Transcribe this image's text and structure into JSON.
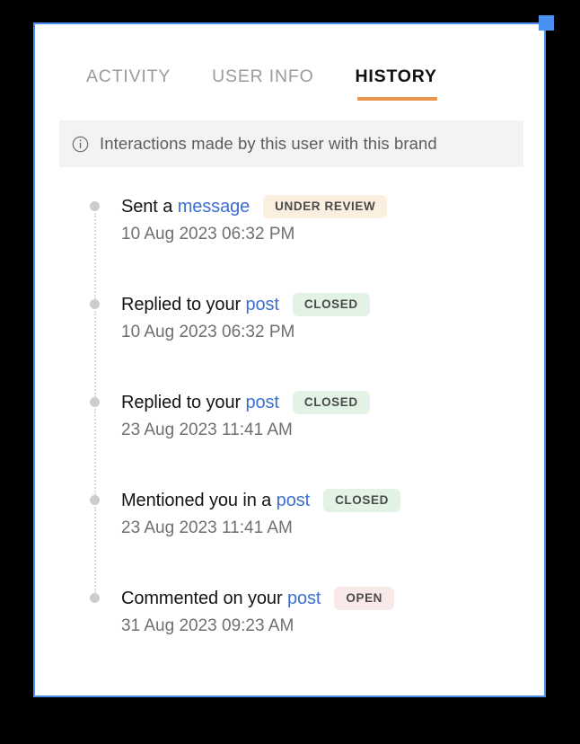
{
  "frame": {
    "accent_color": "#4a90f0",
    "handle_name": "resize-handle-top-right"
  },
  "tabs": [
    {
      "id": "activity",
      "label": "ACTIVITY",
      "active": false
    },
    {
      "id": "user-info",
      "label": "USER INFO",
      "active": false
    },
    {
      "id": "history",
      "label": "HISTORY",
      "active": true
    }
  ],
  "info_banner": {
    "icon": "info-circle-icon",
    "text": "Interactions made by this user with this brand",
    "background": "#f3f3f3"
  },
  "history": {
    "items": [
      {
        "prefix": "Sent a ",
        "link": "message",
        "suffix": "",
        "badge": "UNDER REVIEW",
        "badge_state": "under-review",
        "badge_color": "#fbf0df",
        "date": "10 Aug 2023 06:32 PM"
      },
      {
        "prefix": "Replied to your ",
        "link": "post",
        "suffix": "",
        "badge": "CLOSED",
        "badge_state": "closed",
        "badge_color": "#e2f3e6",
        "date": "10 Aug 2023 06:32 PM"
      },
      {
        "prefix": "Replied to your ",
        "link": "post",
        "suffix": "",
        "badge": "CLOSED",
        "badge_state": "closed",
        "badge_color": "#e2f3e6",
        "date": "23 Aug 2023 11:41 AM"
      },
      {
        "prefix": "Mentioned you in a ",
        "link": "post",
        "suffix": "",
        "badge": "CLOSED",
        "badge_state": "closed",
        "badge_color": "#e2f3e6",
        "date": "23 Aug 2023 11:41 AM"
      },
      {
        "prefix": "Commented on your ",
        "link": "post",
        "suffix": "",
        "badge": "OPEN",
        "badge_state": "open",
        "badge_color": "#fae9e9",
        "date": "31 Aug 2023 09:23 AM"
      }
    ]
  }
}
